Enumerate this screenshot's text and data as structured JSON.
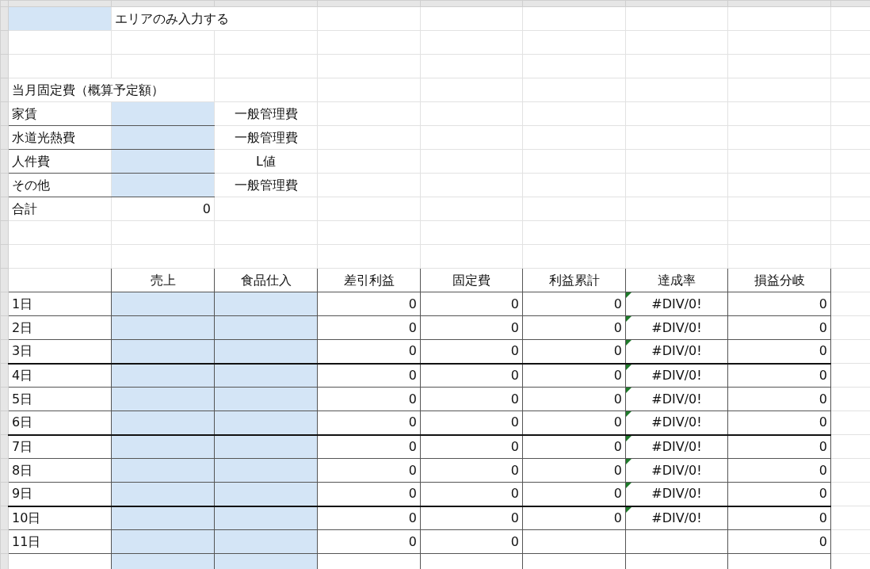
{
  "legend": {
    "text": "エリアのみ入力する"
  },
  "fixed_costs": {
    "title": "当月固定費（概算予定額）",
    "items": [
      {
        "label": "家賃",
        "category": "一般管理費"
      },
      {
        "label": "水道光熱費",
        "category": "一般管理費"
      },
      {
        "label": "人件費",
        "category": "L値"
      },
      {
        "label": "その他",
        "category": "一般管理費"
      }
    ],
    "total": {
      "label": "合計",
      "value": "0"
    }
  },
  "table": {
    "columns": [
      {
        "kind": "label"
      },
      {
        "label": "売上",
        "kind": "input"
      },
      {
        "label": "食品仕入",
        "kind": "input"
      },
      {
        "label": "差引利益",
        "kind": "number"
      },
      {
        "label": "固定費",
        "kind": "number"
      },
      {
        "label": "利益累計",
        "kind": "number"
      },
      {
        "label": "達成率",
        "kind": "rate"
      },
      {
        "label": "損益分岐",
        "kind": "number"
      }
    ],
    "rows": [
      {
        "cells": [
          "1日",
          "",
          "",
          "0",
          "0",
          "0",
          "#DIV/0!",
          "0"
        ],
        "flagged": true,
        "week_end": false
      },
      {
        "cells": [
          "2日",
          "",
          "",
          "0",
          "0",
          "0",
          "#DIV/0!",
          "0"
        ],
        "flagged": true,
        "week_end": false
      },
      {
        "cells": [
          "3日",
          "",
          "",
          "0",
          "0",
          "0",
          "#DIV/0!",
          "0"
        ],
        "flagged": true,
        "week_end": true
      },
      {
        "cells": [
          "4日",
          "",
          "",
          "0",
          "0",
          "0",
          "#DIV/0!",
          "0"
        ],
        "flagged": true,
        "week_end": false
      },
      {
        "cells": [
          "5日",
          "",
          "",
          "0",
          "0",
          "0",
          "#DIV/0!",
          "0"
        ],
        "flagged": true,
        "week_end": false
      },
      {
        "cells": [
          "6日",
          "",
          "",
          "0",
          "0",
          "0",
          "#DIV/0!",
          "0"
        ],
        "flagged": true,
        "week_end": true
      },
      {
        "cells": [
          "7日",
          "",
          "",
          "0",
          "0",
          "0",
          "#DIV/0!",
          "0"
        ],
        "flagged": true,
        "week_end": false
      },
      {
        "cells": [
          "8日",
          "",
          "",
          "0",
          "0",
          "0",
          "#DIV/0!",
          "0"
        ],
        "flagged": true,
        "week_end": false
      },
      {
        "cells": [
          "9日",
          "",
          "",
          "0",
          "0",
          "0",
          "#DIV/0!",
          "0"
        ],
        "flagged": true,
        "week_end": true
      },
      {
        "cells": [
          "10日",
          "",
          "",
          "0",
          "0",
          "0",
          "#DIV/0!",
          "0"
        ],
        "flagged": true,
        "week_end": false
      },
      {
        "cells": [
          "11日",
          "",
          "",
          "0",
          "0",
          "",
          "",
          "0"
        ],
        "flagged": false,
        "week_end": false
      }
    ]
  }
}
